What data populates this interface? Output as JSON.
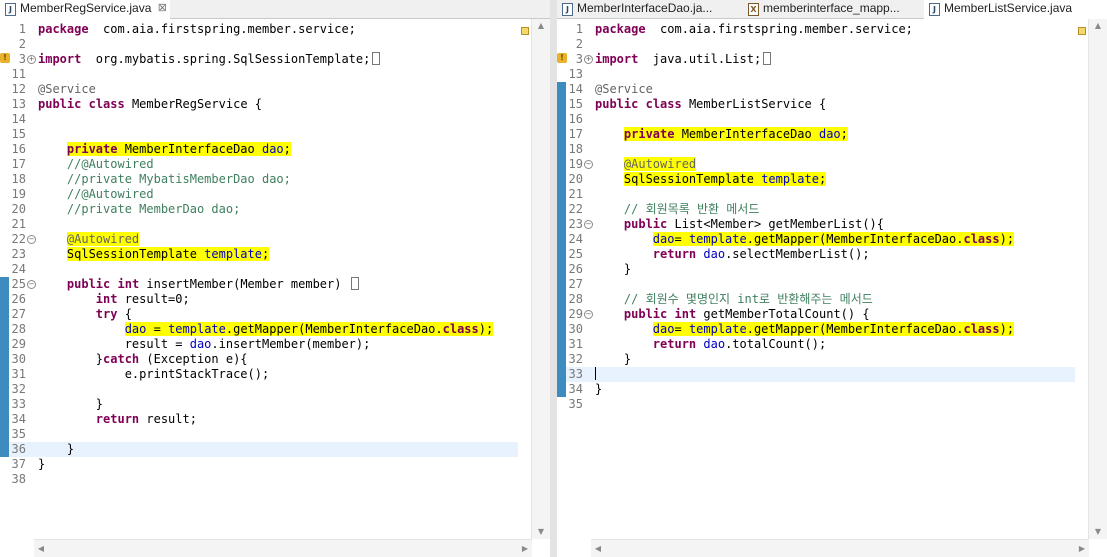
{
  "left": {
    "tab_label": "MemberRegService.java",
    "tab_close": "⊠",
    "tab_icon": "J",
    "lines": [
      {
        "n": "1",
        "segs": [
          [
            "kw",
            "package"
          ],
          [
            "",
            "  com.aia.firstspring.member.service;"
          ]
        ]
      },
      {
        "n": "2",
        "segs": []
      },
      {
        "n": "3",
        "fold": "+",
        "warn": true,
        "segs": [
          [
            "kw",
            "import"
          ],
          [
            "",
            "  org.mybatis.spring.SqlSessionTemplate;"
          ],
          [
            "box",
            ""
          ]
        ]
      },
      {
        "n": "11",
        "segs": []
      },
      {
        "n": "12",
        "segs": [
          [
            "ann",
            "@Service"
          ]
        ]
      },
      {
        "n": "13",
        "segs": [
          [
            "kw",
            "public"
          ],
          [
            "",
            " "
          ],
          [
            "kw",
            "class"
          ],
          [
            "",
            " MemberRegService {"
          ]
        ]
      },
      {
        "n": "14",
        "segs": []
      },
      {
        "n": "15",
        "segs": []
      },
      {
        "n": "16",
        "segs": [
          [
            "",
            "    "
          ],
          [
            "kw hl",
            "private"
          ],
          [
            "hl",
            " MemberInterfaceDao "
          ],
          [
            "fld hl",
            "dao"
          ],
          [
            "hl",
            ";"
          ]
        ]
      },
      {
        "n": "17",
        "segs": [
          [
            "",
            "    "
          ],
          [
            "cm",
            "//@Autowired"
          ]
        ]
      },
      {
        "n": "18",
        "segs": [
          [
            "",
            "    "
          ],
          [
            "cm",
            "//private MybatisMemberDao dao;"
          ]
        ]
      },
      {
        "n": "19",
        "segs": [
          [
            "",
            "    "
          ],
          [
            "cm",
            "//@Autowired"
          ]
        ]
      },
      {
        "n": "20",
        "segs": [
          [
            "",
            "    "
          ],
          [
            "cm",
            "//private MemberDao dao;"
          ]
        ]
      },
      {
        "n": "21",
        "segs": []
      },
      {
        "n": "22",
        "fold": "-",
        "segs": [
          [
            "",
            "    "
          ],
          [
            "ann hl",
            "@Autowired"
          ]
        ]
      },
      {
        "n": "23",
        "segs": [
          [
            "",
            "    "
          ],
          [
            "hl",
            "SqlSessionTemplate "
          ],
          [
            "fld hl",
            "template"
          ],
          [
            "hl",
            ";"
          ]
        ]
      },
      {
        "n": "24",
        "segs": []
      },
      {
        "n": "25",
        "fold": "-",
        "mark": true,
        "segs": [
          [
            "",
            "    "
          ],
          [
            "kw",
            "public"
          ],
          [
            "",
            " "
          ],
          [
            "kw",
            "int"
          ],
          [
            "",
            " insertMember(Member member) "
          ],
          [
            "box",
            ""
          ]
        ]
      },
      {
        "n": "26",
        "mark": true,
        "segs": [
          [
            "",
            "        "
          ],
          [
            "kw",
            "int"
          ],
          [
            "",
            " result=0;"
          ]
        ]
      },
      {
        "n": "27",
        "mark": true,
        "segs": [
          [
            "",
            "        "
          ],
          [
            "kw",
            "try"
          ],
          [
            "",
            " {"
          ]
        ]
      },
      {
        "n": "28",
        "mark": true,
        "segs": [
          [
            "",
            "            "
          ],
          [
            "fld hl",
            "dao"
          ],
          [
            "hl",
            " = "
          ],
          [
            "fld hl",
            "template"
          ],
          [
            "hl",
            ".getMapper(MemberInterfaceDao."
          ],
          [
            "kw hl",
            "class"
          ],
          [
            "hl",
            ");"
          ]
        ]
      },
      {
        "n": "29",
        "mark": true,
        "segs": [
          [
            "",
            "            result = "
          ],
          [
            "fld",
            "dao"
          ],
          [
            "",
            ".insertMember(member);"
          ]
        ]
      },
      {
        "n": "30",
        "mark": true,
        "segs": [
          [
            "",
            "        }"
          ],
          [
            "kw",
            "catch"
          ],
          [
            "",
            " (Exception e){"
          ]
        ]
      },
      {
        "n": "31",
        "mark": true,
        "segs": [
          [
            "",
            "            e.printStackTrace();"
          ]
        ]
      },
      {
        "n": "32",
        "mark": true,
        "segs": []
      },
      {
        "n": "33",
        "mark": true,
        "segs": [
          [
            "",
            "        }"
          ]
        ]
      },
      {
        "n": "34",
        "mark": true,
        "segs": [
          [
            "",
            "        "
          ],
          [
            "kw",
            "return"
          ],
          [
            "",
            " result;"
          ]
        ]
      },
      {
        "n": "35",
        "mark": true,
        "segs": []
      },
      {
        "n": "36",
        "mark": true,
        "current": true,
        "segs": [
          [
            "",
            "    }"
          ]
        ]
      },
      {
        "n": "37",
        "segs": [
          [
            "",
            "}"
          ]
        ]
      },
      {
        "n": "38",
        "segs": []
      }
    ]
  },
  "right": {
    "tabs": [
      {
        "label": "MemberInterfaceDao.ja...",
        "icon": "J",
        "active": false
      },
      {
        "label": "memberinterface_mapp...",
        "icon": "X",
        "active": false
      },
      {
        "label": "MemberListService.java",
        "icon": "J",
        "active": true
      }
    ],
    "lines": [
      {
        "n": "1",
        "segs": [
          [
            "kw",
            "package"
          ],
          [
            "",
            "  com.aia.firstspring.member.service;"
          ]
        ]
      },
      {
        "n": "2",
        "segs": []
      },
      {
        "n": "3",
        "fold": "+",
        "warn": true,
        "segs": [
          [
            "kw",
            "import"
          ],
          [
            "",
            "  java.util.List;"
          ],
          [
            "box",
            ""
          ]
        ]
      },
      {
        "n": "13",
        "segs": []
      },
      {
        "n": "14",
        "mark": true,
        "segs": [
          [
            "ann",
            "@Service"
          ]
        ]
      },
      {
        "n": "15",
        "mark": true,
        "segs": [
          [
            "kw",
            "public"
          ],
          [
            "",
            " "
          ],
          [
            "kw",
            "class"
          ],
          [
            "",
            " MemberListService {"
          ]
        ]
      },
      {
        "n": "16",
        "mark": true,
        "segs": []
      },
      {
        "n": "17",
        "mark": true,
        "segs": [
          [
            "",
            "    "
          ],
          [
            "kw hl",
            "private"
          ],
          [
            "hl",
            " MemberInterfaceDao "
          ],
          [
            "fld hl",
            "dao"
          ],
          [
            "hl",
            ";"
          ]
        ]
      },
      {
        "n": "18",
        "mark": true,
        "segs": []
      },
      {
        "n": "19",
        "fold": "-",
        "mark": true,
        "segs": [
          [
            "",
            "    "
          ],
          [
            "ann hl",
            "@Autowired"
          ]
        ]
      },
      {
        "n": "20",
        "mark": true,
        "segs": [
          [
            "",
            "    "
          ],
          [
            "hl",
            "SqlSessionTemplate "
          ],
          [
            "fld hl",
            "template"
          ],
          [
            "hl",
            ";"
          ]
        ]
      },
      {
        "n": "21",
        "mark": true,
        "segs": []
      },
      {
        "n": "22",
        "mark": true,
        "segs": [
          [
            "",
            "    "
          ],
          [
            "cm",
            "// 회원목록 반환 메서드"
          ]
        ]
      },
      {
        "n": "23",
        "fold": "-",
        "mark": true,
        "segs": [
          [
            "",
            "    "
          ],
          [
            "kw",
            "public"
          ],
          [
            "",
            " List<Member> getMemberList(){"
          ]
        ]
      },
      {
        "n": "24",
        "mark": true,
        "segs": [
          [
            "",
            "        "
          ],
          [
            "fld hl",
            "dao"
          ],
          [
            "hl",
            "= "
          ],
          [
            "fld hl",
            "template"
          ],
          [
            "hl",
            ".getMapper(MemberInterfaceDao."
          ],
          [
            "kw hl",
            "class"
          ],
          [
            "hl",
            ");"
          ]
        ]
      },
      {
        "n": "25",
        "mark": true,
        "segs": [
          [
            "",
            "        "
          ],
          [
            "kw",
            "return"
          ],
          [
            "",
            " "
          ],
          [
            "fld",
            "dao"
          ],
          [
            "",
            ".selectMemberList();"
          ]
        ]
      },
      {
        "n": "26",
        "mark": true,
        "segs": [
          [
            "",
            "    }"
          ]
        ]
      },
      {
        "n": "27",
        "mark": true,
        "segs": []
      },
      {
        "n": "28",
        "mark": true,
        "segs": [
          [
            "",
            "    "
          ],
          [
            "cm",
            "// 회원수 몇명인지 int로 반환해주는 메서드"
          ]
        ]
      },
      {
        "n": "29",
        "fold": "-",
        "mark": true,
        "segs": [
          [
            "",
            "    "
          ],
          [
            "kw",
            "public"
          ],
          [
            "",
            " "
          ],
          [
            "kw",
            "int"
          ],
          [
            "",
            " getMemberTotalCount() {"
          ]
        ]
      },
      {
        "n": "30",
        "mark": true,
        "segs": [
          [
            "",
            "        "
          ],
          [
            "fld hl",
            "dao"
          ],
          [
            "hl",
            "= "
          ],
          [
            "fld hl",
            "template"
          ],
          [
            "hl",
            ".getMapper(MemberInterfaceDao."
          ],
          [
            "kw hl",
            "class"
          ],
          [
            "hl",
            ");"
          ]
        ]
      },
      {
        "n": "31",
        "mark": true,
        "segs": [
          [
            "",
            "        "
          ],
          [
            "kw",
            "return"
          ],
          [
            "",
            " "
          ],
          [
            "fld",
            "dao"
          ],
          [
            "",
            ".totalCount();"
          ]
        ]
      },
      {
        "n": "32",
        "mark": true,
        "segs": [
          [
            "",
            "    }"
          ]
        ]
      },
      {
        "n": "33",
        "mark": true,
        "current": true,
        "caret": true,
        "segs": []
      },
      {
        "n": "34",
        "mark": true,
        "segs": [
          [
            "",
            "}"
          ]
        ]
      },
      {
        "n": "35",
        "segs": []
      }
    ]
  },
  "scroll_icons": {
    "up": "▲",
    "down": "▼",
    "left": "◀",
    "right": "▶"
  },
  "colors": {
    "keyword": "#7f0055",
    "comment": "#3f7f5f",
    "field": "#0000c0",
    "annotation": "#646464",
    "highlight": "#ffff00",
    "change_bar": "#3d8bbf"
  }
}
